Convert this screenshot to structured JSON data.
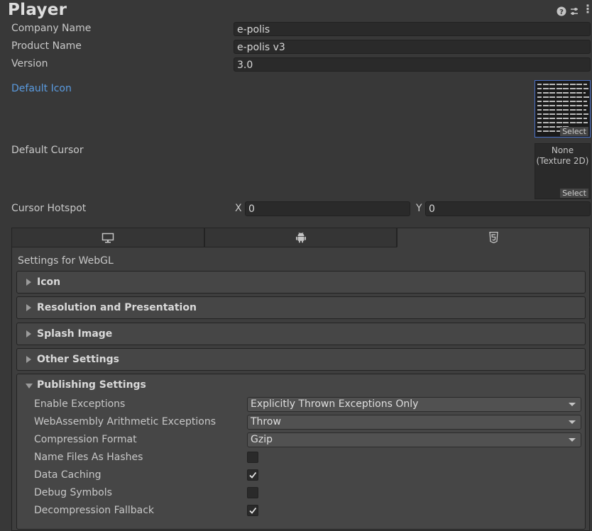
{
  "header": {
    "title": "Player"
  },
  "fields": {
    "company_name": {
      "label": "Company Name",
      "value": "e-polis"
    },
    "product_name": {
      "label": "Product Name",
      "value": "e-polis v3"
    },
    "version": {
      "label": "Version",
      "value": "3.0"
    }
  },
  "default_icon": {
    "label": "Default Icon",
    "select_label": "Select"
  },
  "default_cursor": {
    "label": "Default Cursor",
    "none_label": "None",
    "type_label": "(Texture 2D)",
    "select_label": "Select"
  },
  "cursor_hotspot": {
    "label": "Cursor Hotspot",
    "x_label": "X",
    "x_value": "0",
    "y_label": "Y",
    "y_value": "0"
  },
  "platform_tabs": [
    {
      "icon": "monitor-icon",
      "active": false
    },
    {
      "icon": "android-icon",
      "active": false
    },
    {
      "icon": "html5-icon",
      "active": true
    }
  ],
  "settings_for": "Settings for WebGL",
  "sections": [
    {
      "label": "Icon",
      "expanded": false
    },
    {
      "label": "Resolution and Presentation",
      "expanded": false
    },
    {
      "label": "Splash Image",
      "expanded": false
    },
    {
      "label": "Other Settings",
      "expanded": false
    },
    {
      "label": "Publishing Settings",
      "expanded": true
    }
  ],
  "publishing": {
    "enable_exceptions": {
      "label": "Enable Exceptions",
      "value": "Explicitly Thrown Exceptions Only"
    },
    "wasm_arith": {
      "label": "WebAssembly Arithmetic Exceptions",
      "value": "Throw"
    },
    "compression": {
      "label": "Compression Format",
      "value": "Gzip"
    },
    "name_files_hashes": {
      "label": "Name Files As Hashes",
      "checked": false
    },
    "data_caching": {
      "label": "Data Caching",
      "checked": true
    },
    "debug_symbols": {
      "label": "Debug Symbols",
      "checked": false
    },
    "decompression_fallback": {
      "label": "Decompression Fallback",
      "checked": true
    }
  },
  "colors": {
    "background": "#383838",
    "panel": "#3e3e3e",
    "section": "#464646",
    "link": "#5a9be0",
    "field": "#2a2a2a"
  }
}
